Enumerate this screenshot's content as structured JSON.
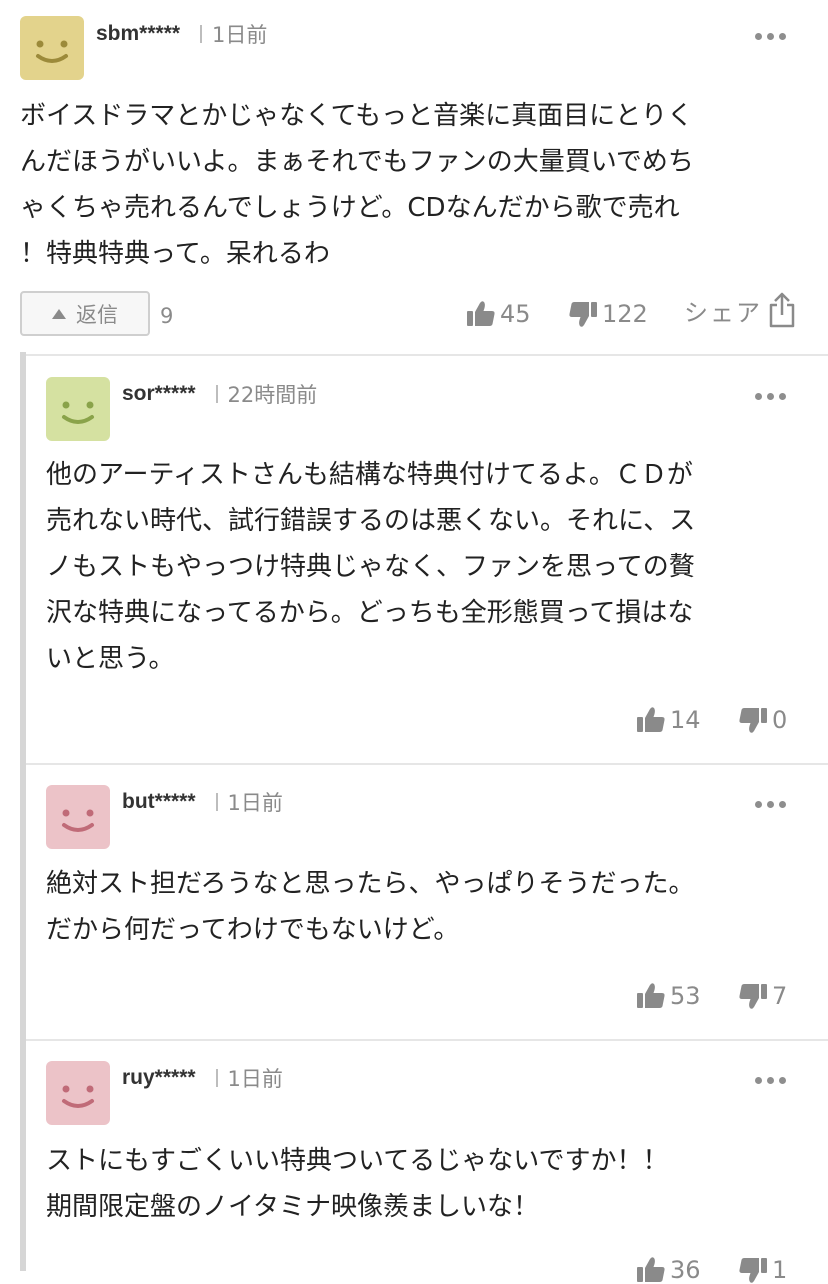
{
  "comment": {
    "username": "sbm*****",
    "time": "1日前",
    "avatar_color": "#e3d38c",
    "avatar_face_color": "#9c8a3a",
    "text_lines": [
      "ボイスドラマとかじゃなくてもっと音楽に真面目にとりく",
      "んだほうがいいよ。まぁそれでもファンの大量買いでめち",
      "ゃくちゃ売れるんでしょうけど。CDなんだから歌で売れ",
      "！特典特典って。呆れるわ"
    ],
    "reply_label": "返信",
    "reply_count": "9",
    "likes": "45",
    "dislikes": "122",
    "share_label": "シェア"
  },
  "replies": [
    {
      "username": "sor*****",
      "time": "22時間前",
      "avatar_color": "#d5e1a1",
      "avatar_face_color": "#8aa34a",
      "text_lines": [
        "他のアーティストさんも結構な特典付けてるよ。ＣＤが",
        "売れない時代、試行錯誤するのは悪くない。それに、ス",
        "ノもストもやっつけ特典じゃなく、ファンを思っての贅",
        "沢な特典になってるから。どっちも全形態買って損はな",
        "いと思う。"
      ],
      "likes": "14",
      "dislikes": "0"
    },
    {
      "username": "but*****",
      "time": "1日前",
      "avatar_color": "#ecc3c8",
      "avatar_face_color": "#c06b78",
      "text_lines": [
        "絶対スト担だろうなと思ったら、やっぱりそうだった。",
        "だから何だってわけでもないけど。"
      ],
      "likes": "53",
      "dislikes": "7"
    },
    {
      "username": "ruy*****",
      "time": "1日前",
      "avatar_color": "#ecc3c8",
      "avatar_face_color": "#c06b78",
      "text_lines": [
        "ストにもすごくいい特典ついてるじゃないですか！！",
        "期間限定盤のノイタミナ映像羨ましいな！"
      ],
      "likes": "36",
      "dislikes": "1"
    }
  ],
  "icons": {
    "more": "more-options-icon",
    "like": "thumbs-up-icon",
    "dislike": "thumbs-down-icon",
    "share": "share-icon",
    "reply": "caret-up-icon"
  }
}
